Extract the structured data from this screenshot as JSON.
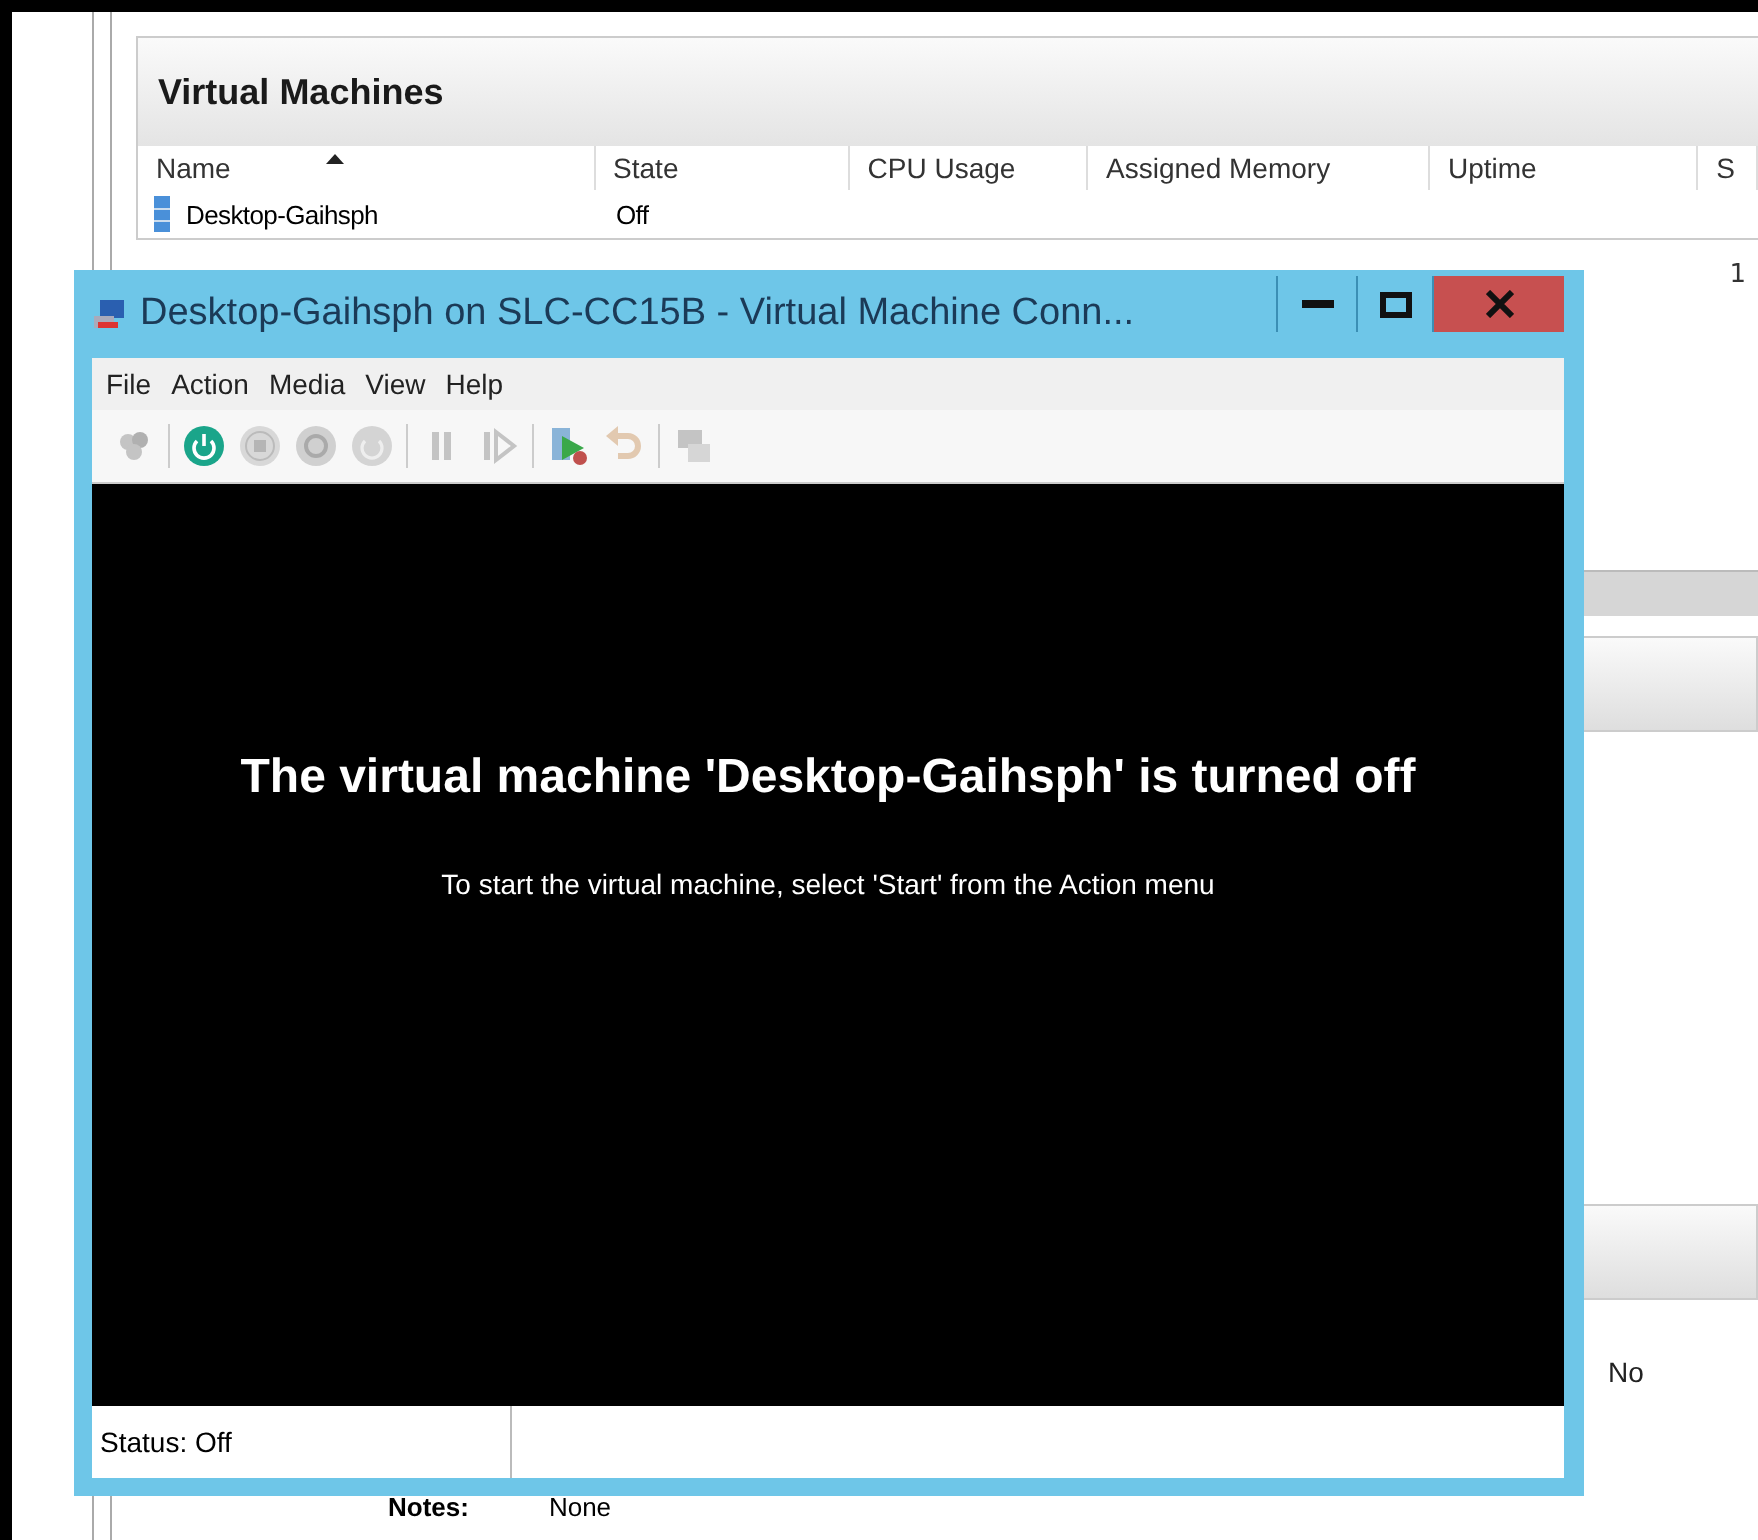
{
  "manager": {
    "section_title": "Virtual Machines",
    "columns": [
      "Name",
      "State",
      "CPU Usage",
      "Assigned Memory",
      "Uptime",
      "S"
    ],
    "rows": [
      {
        "name": "Desktop-Gaihsph",
        "state": "Off"
      }
    ],
    "partial_cell": "1",
    "detail_value": "No",
    "notes_label": "Notes:",
    "notes_value": "None"
  },
  "vm_window": {
    "title": "Desktop-Gaihsph on SLC-CC15B - Virtual Machine Conn...",
    "menu": [
      "File",
      "Action",
      "Media",
      "View",
      "Help"
    ],
    "toolbar": [
      [
        {
          "kind": "ctrl-alt-del",
          "disabled": true
        }
      ],
      [
        {
          "kind": "start",
          "disabled": false
        },
        {
          "kind": "turn-off",
          "disabled": true
        },
        {
          "kind": "shut-down",
          "disabled": true
        },
        {
          "kind": "save",
          "disabled": true
        }
      ],
      [
        {
          "kind": "pause",
          "disabled": true
        },
        {
          "kind": "reset",
          "disabled": true
        }
      ],
      [
        {
          "kind": "checkpoint",
          "disabled": false
        },
        {
          "kind": "revert",
          "disabled": true
        }
      ],
      [
        {
          "kind": "enhanced-session",
          "disabled": true
        }
      ]
    ],
    "message": "The virtual machine 'Desktop-Gaihsph' is turned off",
    "hint": "To start the virtual machine, select 'Start' from the Action menu",
    "status": "Status: Off"
  }
}
